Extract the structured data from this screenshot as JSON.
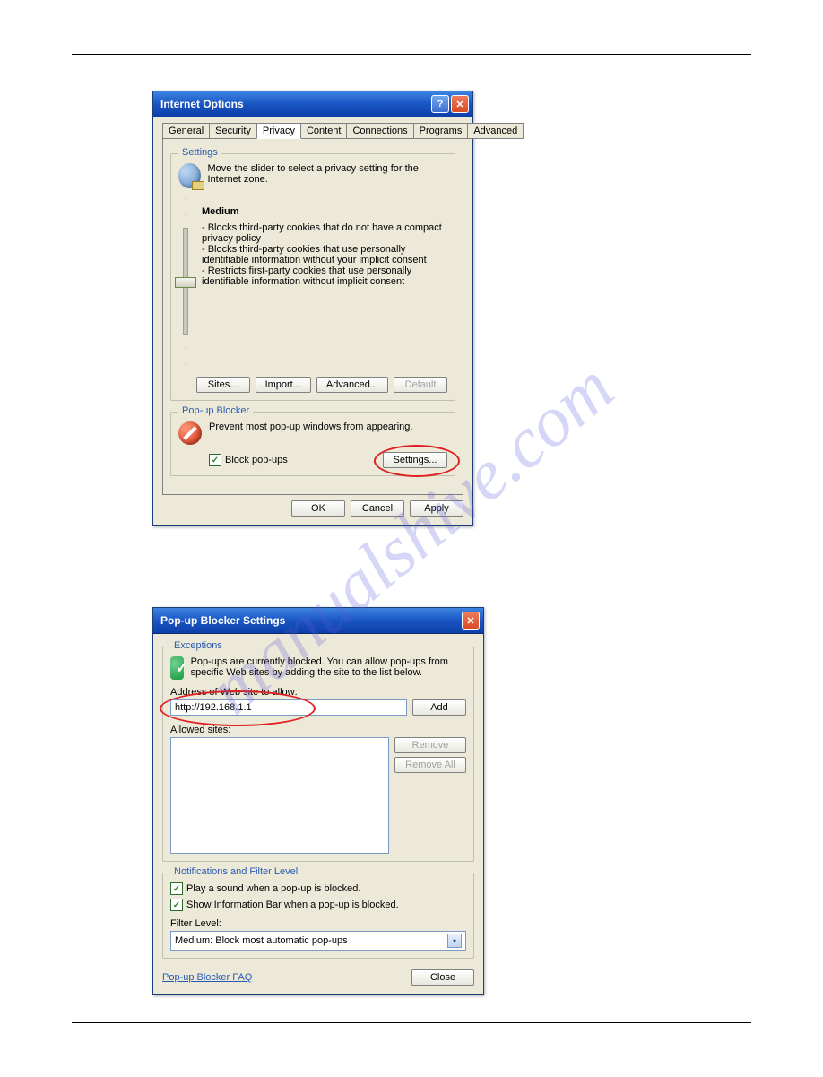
{
  "watermark": "manualshive.com",
  "dialog1": {
    "title": "Internet Options",
    "tabs": [
      "General",
      "Security",
      "Privacy",
      "Content",
      "Connections",
      "Programs",
      "Advanced"
    ],
    "active_tab": "Privacy",
    "settings": {
      "legend": "Settings",
      "intro": "Move the slider to select a privacy setting for the Internet zone.",
      "level_name": "Medium",
      "bullet1": "- Blocks third-party cookies that do not have a compact privacy policy",
      "bullet2": "- Blocks third-party cookies that use personally identifiable information without your implicit consent",
      "bullet3": "- Restricts first-party cookies that use personally identifiable information without implicit consent",
      "btn_sites": "Sites...",
      "btn_import": "Import...",
      "btn_advanced": "Advanced...",
      "btn_default": "Default"
    },
    "popup": {
      "legend": "Pop-up Blocker",
      "intro": "Prevent most pop-up windows from appearing.",
      "checkbox_label": "Block pop-ups",
      "btn_settings": "Settings..."
    },
    "footer": {
      "ok": "OK",
      "cancel": "Cancel",
      "apply": "Apply"
    }
  },
  "dialog2": {
    "title": "Pop-up Blocker Settings",
    "exceptions": {
      "legend": "Exceptions",
      "intro": "Pop-ups are currently blocked. You can allow pop-ups from specific Web sites by adding the site to the list below.",
      "addr_label": "Address of Web site to allow:",
      "addr_value": "http://192.168.1.1",
      "btn_add": "Add",
      "allowed_label": "Allowed sites:",
      "btn_remove": "Remove",
      "btn_removeall": "Remove All"
    },
    "notifications": {
      "legend": "Notifications and Filter Level",
      "cb1": "Play a sound when a pop-up is blocked.",
      "cb2": "Show Information Bar when a pop-up is blocked.",
      "filter_label": "Filter Level:",
      "filter_value": "Medium: Block most automatic pop-ups"
    },
    "faq": "Pop-up Blocker FAQ",
    "btn_close": "Close"
  }
}
